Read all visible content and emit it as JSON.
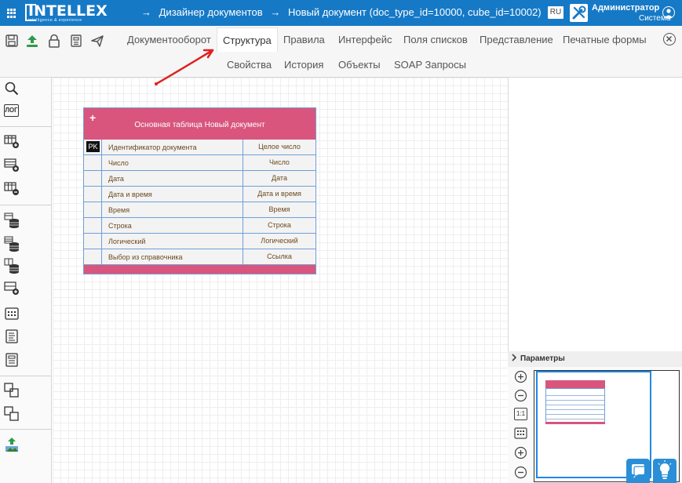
{
  "header": {
    "logo_text": "INTELLEX",
    "logo_tagline": "intelligence & experience",
    "breadcrumb": [
      {
        "arrow": "→",
        "label": "Дизайнер документов"
      },
      {
        "arrow": "→",
        "label": "Новый документ (doc_type_id=10000, cube_id=10002)"
      }
    ],
    "language": "RU",
    "user_name": "Администратор",
    "user_role": "Система"
  },
  "toolbar": {
    "icons": [
      "save-icon",
      "upload-icon",
      "lock-icon",
      "template-icon",
      "send-icon"
    ]
  },
  "tabs_row1": [
    "Документооборот",
    "Структура",
    "Правила",
    "Интерфейс",
    "Поля списков",
    "Представление",
    "Печатные формы"
  ],
  "tabs_row2": [
    "Свойства",
    "История",
    "Объекты",
    "SOAP Запросы"
  ],
  "active_tab": "Структура",
  "sidebar": {
    "log_label": "ЛОГ"
  },
  "entity": {
    "add_label": "+",
    "title": "Основная таблица Новый документ",
    "pk_label": "PK",
    "rows": [
      {
        "name": "Идентификатор документа",
        "type": "Целое число"
      },
      {
        "name": "Число",
        "type": "Число"
      },
      {
        "name": "Дата",
        "type": "Дата"
      },
      {
        "name": "Дата и время",
        "type": "Дата и время"
      },
      {
        "name": "Время",
        "type": "Время"
      },
      {
        "name": "Строка",
        "type": "Строка"
      },
      {
        "name": "Логический",
        "type": "Логический"
      },
      {
        "name": "Выбор из справочника",
        "type": "Ссылка"
      }
    ]
  },
  "right_panel": {
    "params_label": "Параметры",
    "zoom_reset_label": "1:1"
  },
  "colors": {
    "header_blue": "#1679c6",
    "entity_pink": "#d9557d",
    "entity_border": "#6e9fd8",
    "annotation_red": "#e02020"
  }
}
